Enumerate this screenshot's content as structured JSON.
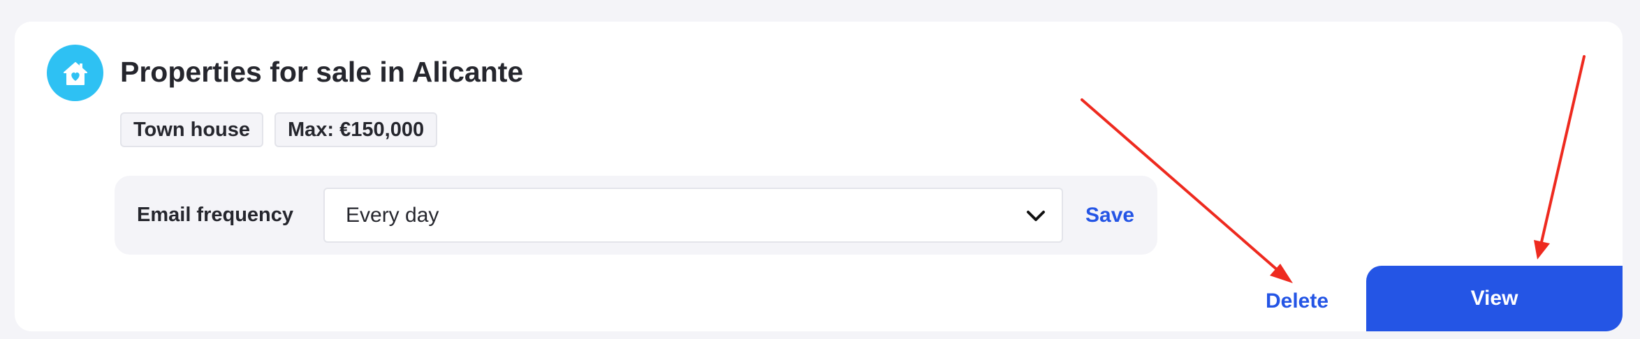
{
  "card": {
    "icon": "house-heart-icon",
    "title": "Properties for sale in Alicante",
    "tags": [
      "Town house",
      "Max: €150,000"
    ]
  },
  "email_frequency": {
    "label": "Email frequency",
    "selected": "Every day",
    "dropdown_icon": "chevron-down-icon",
    "save_label": "Save"
  },
  "actions": {
    "delete_label": "Delete",
    "view_label": "View"
  },
  "colors": {
    "icon_bg": "#2ec1f3",
    "link": "#2455e5",
    "primary_button": "#2455e5",
    "arrow_annotation": "#ee2a1f",
    "page_bg": "#f4f4f8"
  }
}
